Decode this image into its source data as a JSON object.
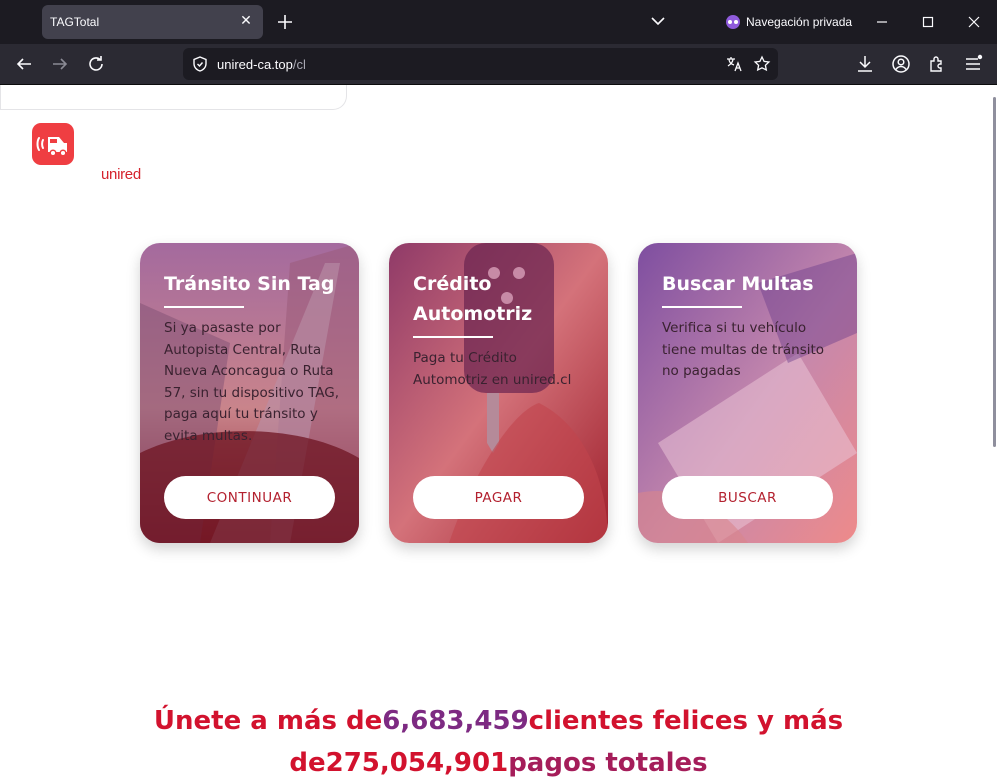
{
  "browser": {
    "tab_title": "TAGTotal",
    "private_label": "Navegación privada",
    "url_host": "unired-ca.top",
    "url_path": "/cl"
  },
  "logo": {
    "text": "unired",
    "icon": "car-signal-icon",
    "color": "#ef3e42"
  },
  "cards": [
    {
      "title": "Tránsito Sin Tag",
      "text": "Si ya pasaste por Autopista Central, Ruta Nueva Aconcagua o Ruta 57, sin tu dispositivo TAG, paga aquí tu tránsito y evita multas.",
      "button": "CONTINUAR"
    },
    {
      "title": "Crédito Automotriz",
      "text": "Paga tu Crédito Automotriz en unired.cl",
      "button": "PAGAR"
    },
    {
      "title": "Buscar Multas",
      "text": "Verifica si tu vehículo tiene multas de tránsito no pagadas",
      "button": "BUSCAR"
    }
  ],
  "promo": {
    "part1": "Únete a más de",
    "clients": "6,683,459",
    "part2": "clientes felices y más de",
    "payments": "275,054,901",
    "part3": "pagos totales"
  },
  "colors": {
    "brand_red": "#d2122e",
    "purple": "#7d2a82",
    "button_text": "#b3212f"
  }
}
